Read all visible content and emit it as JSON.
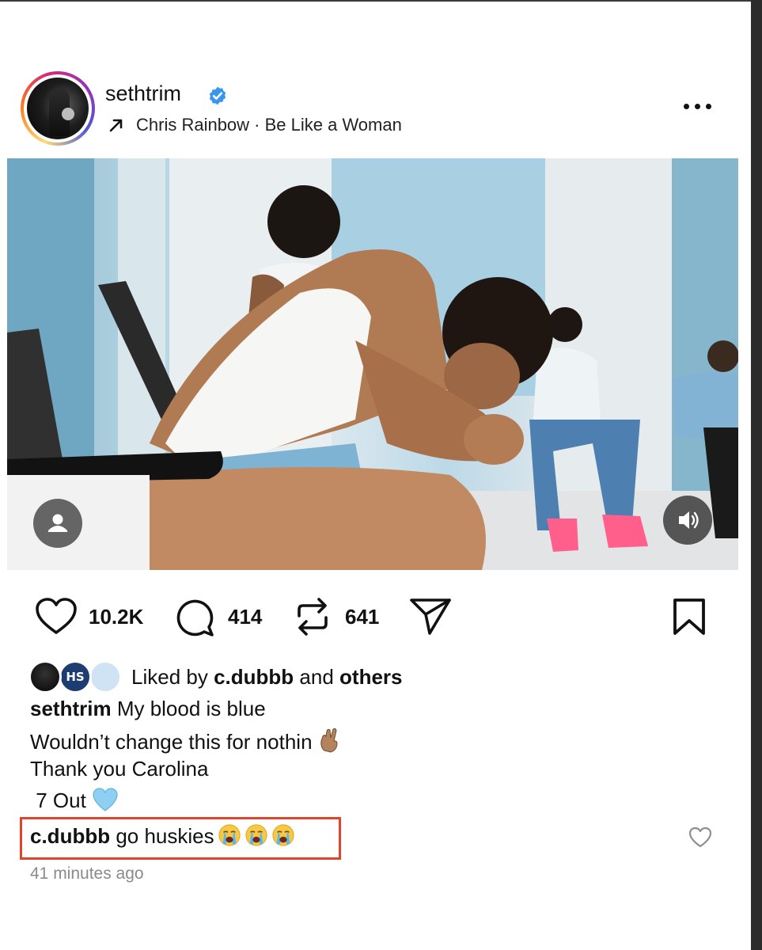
{
  "post": {
    "username": "sethtrim",
    "verified": true,
    "music": "Chris Rainbow · Be Like a Woman",
    "more_icon": "more-horizontal-icon"
  },
  "actions": {
    "likes": "10.2K",
    "comments": "414",
    "reposts": "641"
  },
  "likes_summary": {
    "prefix": "Liked by",
    "user": "c.dubbb",
    "middle": "and",
    "others": "others",
    "avatar_badge": "HS"
  },
  "caption": {
    "user": "sethtrim",
    "lines": [
      "My blood is blue",
      "Wouldn’t change this for nothin",
      "Thank you Carolina",
      " 7 Out"
    ]
  },
  "comment": {
    "user": "c.dubbb",
    "text": "go huskies"
  },
  "timestamp": "41 minutes ago",
  "colors": {
    "verified": "#3797f0",
    "highlight": "#e0452b",
    "timestamp": "#8a8a8a"
  }
}
